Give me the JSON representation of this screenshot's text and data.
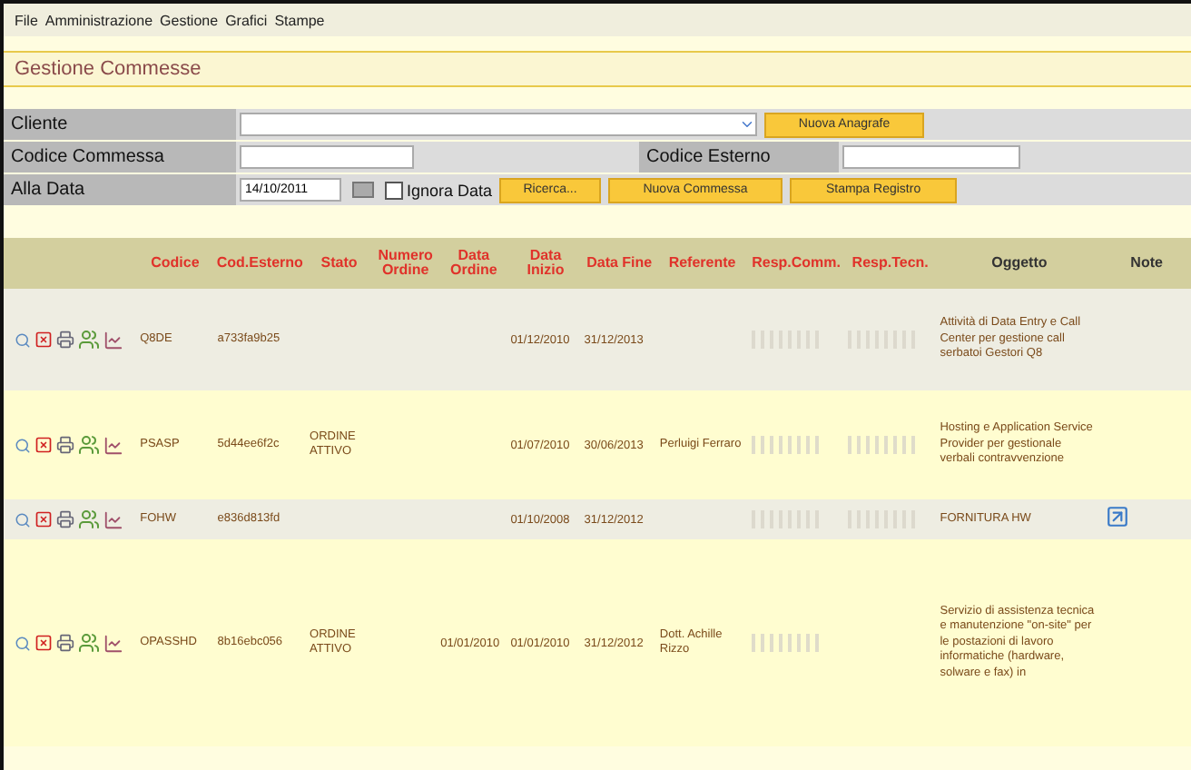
{
  "menu": [
    "File",
    "Amministrazione",
    "Gestione",
    "Grafici",
    "Stampe"
  ],
  "page_title": "Gestione Commesse",
  "form": {
    "cliente_label": "Cliente",
    "new_registry_button": "Nuova Anagrafe",
    "codice_commessa_label": "Codice Commessa",
    "codice_esterno_label": "Codice Esterno",
    "date_label": "Alla Data",
    "date_value": "14/10/2011",
    "ignore_date_label": "Ignora Data",
    "ignore_date_checked": false,
    "search_button": "Ricerca...",
    "new_order_button": "Nuova Commessa",
    "print_button": "Stampa Registro"
  },
  "table": {
    "columns": [
      "Codice",
      "Cod.Esterno",
      "Stato",
      "Numero Ordine",
      "Data Ordine",
      "Data Inizio",
      "Data Fine",
      "Referente",
      "Resp.Comm.",
      "Resp.Tecn.",
      "Oggetto",
      "Note"
    ],
    "rows": [
      {
        "codice": "Q8DE",
        "cod_esterno": "a733fa9b25",
        "stato": "",
        "data_ordine": "",
        "data_inizio": "01/12/2010",
        "data_fine": "31/12/2013",
        "referente": "",
        "resp_comm_blurred": true,
        "resp_tecn_blurred": true,
        "oggetto": "Attività di Data Entry e Call Center per gestione call serbatoi Gestori Q8",
        "note_icon": false
      },
      {
        "codice": "PSASP",
        "cod_esterno": "5d44ee6f2c",
        "stato": "ORDINE ATTIVO",
        "data_ordine": "",
        "data_inizio": "01/07/2010",
        "data_fine": "30/06/2013",
        "referente": "Perluigi Ferraro",
        "resp_comm_blurred": true,
        "resp_tecn_blurred": true,
        "oggetto": "Hosting e Application Service Provider per gestionale verbali contravvenzione",
        "note_icon": false
      },
      {
        "codice": "FOHW",
        "cod_esterno": "e836d813fd",
        "stato": "",
        "data_ordine": "",
        "data_inizio": "01/10/2008",
        "data_fine": "31/12/2012",
        "referente": "",
        "resp_comm_blurred": true,
        "resp_tecn_blurred": true,
        "oggetto": "FORNITURA HW",
        "note_icon": true
      },
      {
        "codice": "OPASSHD",
        "cod_esterno": "8b16ebc056",
        "stato": "ORDINE ATTIVO",
        "data_ordine": "01/01/2010",
        "data_inizio": "01/01/2010",
        "data_fine": "31/12/2012",
        "referente": "Dott. Achille Rizzo",
        "resp_comm_blurred": true,
        "resp_tecn_blurred": false,
        "oggetto": "Servizio di assistenza tecnica e manutenzione \"on-site\" per le postazioni di lavoro informatiche (hardware, solware e fax) in",
        "note_icon": false
      }
    ]
  }
}
